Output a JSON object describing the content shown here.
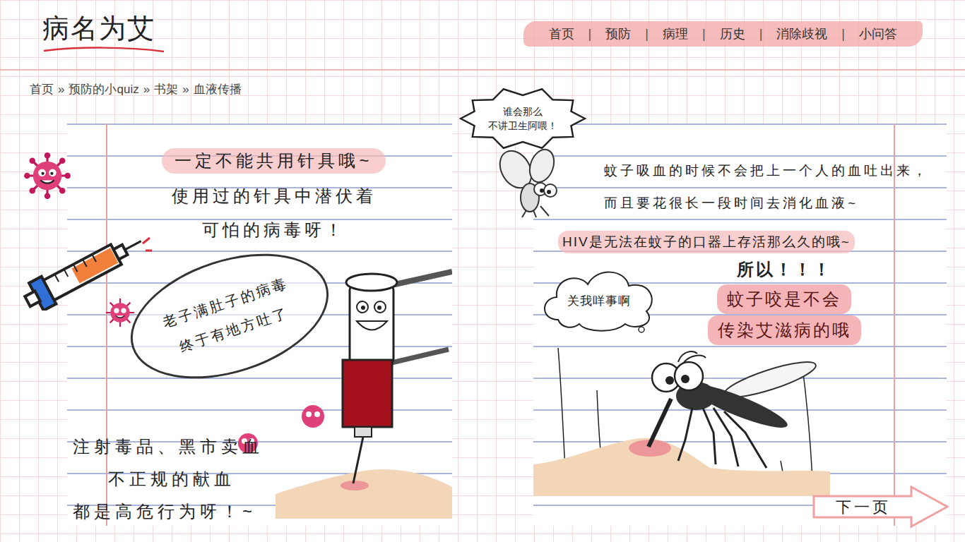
{
  "logo": {
    "text": "病名为艾"
  },
  "nav": {
    "items": [
      "首页",
      "预防",
      "病理",
      "历史",
      "消除歧视",
      "小问答"
    ],
    "separator": "|"
  },
  "breadcrumb": {
    "items": [
      "首页",
      "预防的小quiz",
      "书架",
      "血液传播"
    ],
    "separator": "»"
  },
  "left_page": {
    "title": "一定不能共用针具哦~",
    "lines": [
      "使用过的针具中潜伏着",
      "可怕的病毒呀！"
    ],
    "speech_bubble": [
      "老子满肚子的病毒",
      "终于有地方吐了"
    ],
    "warning": [
      "注射毒品、黑市卖血",
      "不正规的献血",
      "都是高危行为呀！~"
    ]
  },
  "right_page": {
    "shout_bubble": [
      "谁会那么",
      "不讲卫生阿喂！"
    ],
    "lines": [
      "蚊子吸血的时候不会把上一个人的血吐出来，",
      "而且要花很长一段时间去消化血液~"
    ],
    "highlight": "HIV是无法在蚊子的口器上存活那么久的哦~",
    "thought_bubble": "关我咩事啊",
    "conclusion": [
      "所以！！！",
      "蚊子咬是不会",
      "传染艾滋病的哦"
    ]
  },
  "next_button": {
    "label": "下一页"
  }
}
